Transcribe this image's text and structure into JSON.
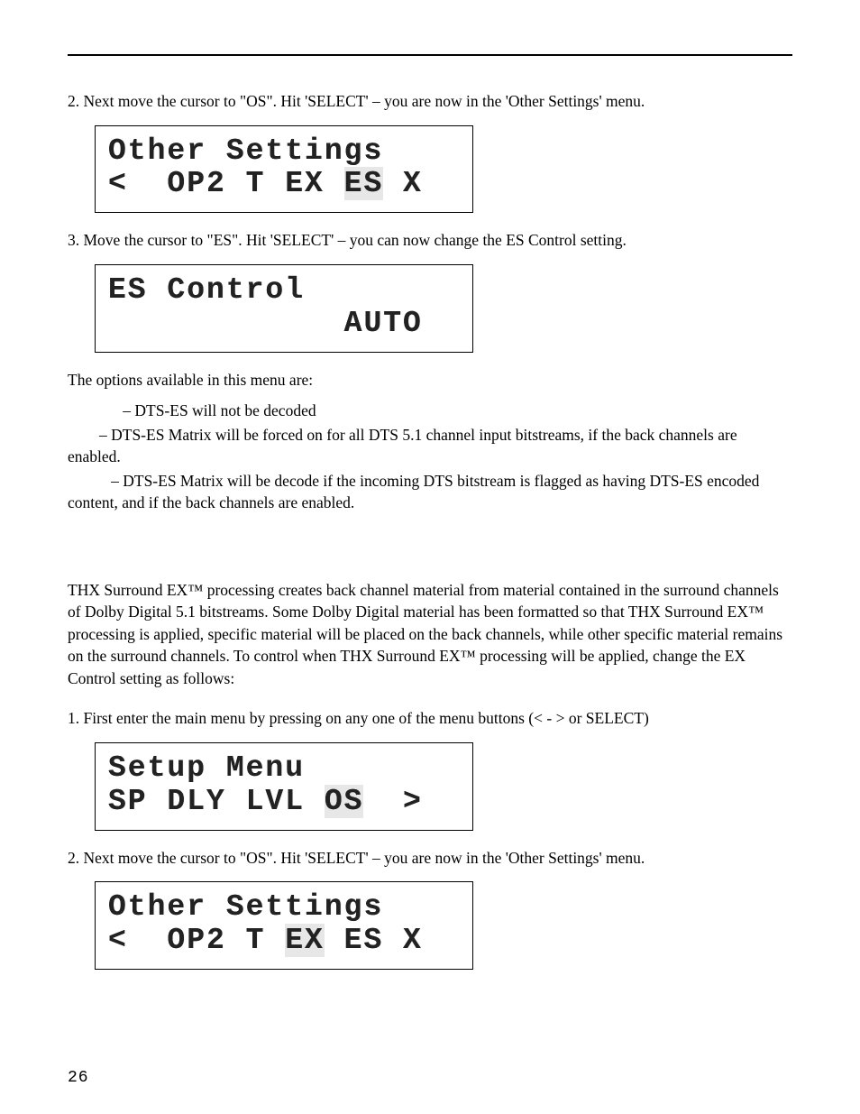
{
  "step2_text": "2.  Next move the cursor to \"OS\".  Hit 'SELECT' – you are now in the 'Other Settings' menu.",
  "lcd1": {
    "line1": "Other Settings",
    "line2_before": "<  OP2 T EX ",
    "line2_hl": "ES",
    "line2_after": " X"
  },
  "step3_text": "3.  Move the cursor to \"ES\". Hit 'SELECT' – you can now change the ES Control setting.",
  "lcd2": {
    "line1": "ES Control",
    "line2": "            AUTO"
  },
  "options_intro": "The options available in this menu are:",
  "option1": "              – DTS-ES will not be decoded",
  "option2": "        – DTS-ES Matrix will be forced on for all DTS 5.1 channel input bitstreams, if the back channels are enabled.",
  "option3": "           – DTS-ES Matrix will be decode if the incoming DTS bitstream is flagged as having DTS-ES encoded content, and if the back channels are enabled.",
  "thx_paragraph": "THX Surround EX™ processing creates back channel material from material contained in the surround channels of Dolby Digital 5.1 bitstreams. Some Dolby Digital material has been formatted so that THX Surround EX™ processing is applied, specific material will be placed on the back channels, while other specific material remains on the surround channels. To control when THX Surround EX™ processing will be applied, change the EX Control setting as follows:",
  "step1b_text": "1.  First enter the main menu by pressing on any one of the menu buttons (< - > or SELECT)",
  "lcd3": {
    "line1": "Setup Menu",
    "line2_before": "SP DLY LVL ",
    "line2_hl": "OS",
    "line2_after": "  >"
  },
  "step2b_text": "2.  Next move the cursor to \"OS\".  Hit 'SELECT' – you are now in the 'Other Settings' menu.",
  "lcd4": {
    "line1": "Other Settings",
    "line2_before": "<  OP2 T ",
    "line2_hl": "EX",
    "line2_after": " ES X"
  },
  "page_number": "26"
}
